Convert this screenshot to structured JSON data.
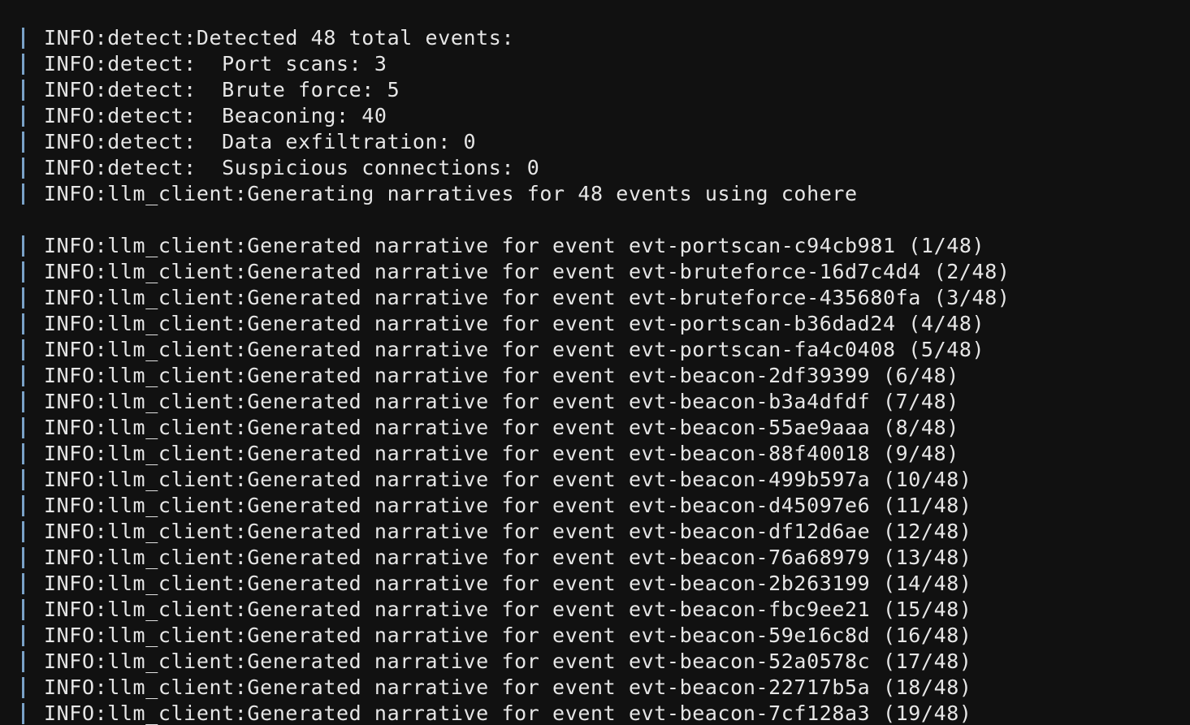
{
  "terminal": {
    "background": "#111111",
    "text_color": "#e6e6e6",
    "gutter_color": "#7aa2c7",
    "lines": [
      "INFO:detect:Detected 48 total events:",
      "INFO:detect:  Port scans: 3",
      "INFO:detect:  Brute force: 5",
      "INFO:detect:  Beaconing: 40",
      "INFO:detect:  Data exfiltration: 0",
      "INFO:detect:  Suspicious connections: 0",
      "INFO:llm_client:Generating narratives for 48 events using cohere",
      "",
      "INFO:llm_client:Generated narrative for event evt-portscan-c94cb981 (1/48)",
      "INFO:llm_client:Generated narrative for event evt-bruteforce-16d7c4d4 (2/48)",
      "INFO:llm_client:Generated narrative for event evt-bruteforce-435680fa (3/48)",
      "INFO:llm_client:Generated narrative for event evt-portscan-b36dad24 (4/48)",
      "INFO:llm_client:Generated narrative for event evt-portscan-fa4c0408 (5/48)",
      "INFO:llm_client:Generated narrative for event evt-beacon-2df39399 (6/48)",
      "INFO:llm_client:Generated narrative for event evt-beacon-b3a4dfdf (7/48)",
      "INFO:llm_client:Generated narrative for event evt-beacon-55ae9aaa (8/48)",
      "INFO:llm_client:Generated narrative for event evt-beacon-88f40018 (9/48)",
      "INFO:llm_client:Generated narrative for event evt-beacon-499b597a (10/48)",
      "INFO:llm_client:Generated narrative for event evt-beacon-d45097e6 (11/48)",
      "INFO:llm_client:Generated narrative for event evt-beacon-df12d6ae (12/48)",
      "INFO:llm_client:Generated narrative for event evt-beacon-76a68979 (13/48)",
      "INFO:llm_client:Generated narrative for event evt-beacon-2b263199 (14/48)",
      "INFO:llm_client:Generated narrative for event evt-beacon-fbc9ee21 (15/48)",
      "INFO:llm_client:Generated narrative for event evt-beacon-59e16c8d (16/48)",
      "INFO:llm_client:Generated narrative for event evt-beacon-52a0578c (17/48)",
      "INFO:llm_client:Generated narrative for event evt-beacon-22717b5a (18/48)",
      "INFO:llm_client:Generated narrative for event evt-beacon-7cf128a3 (19/48)"
    ]
  }
}
